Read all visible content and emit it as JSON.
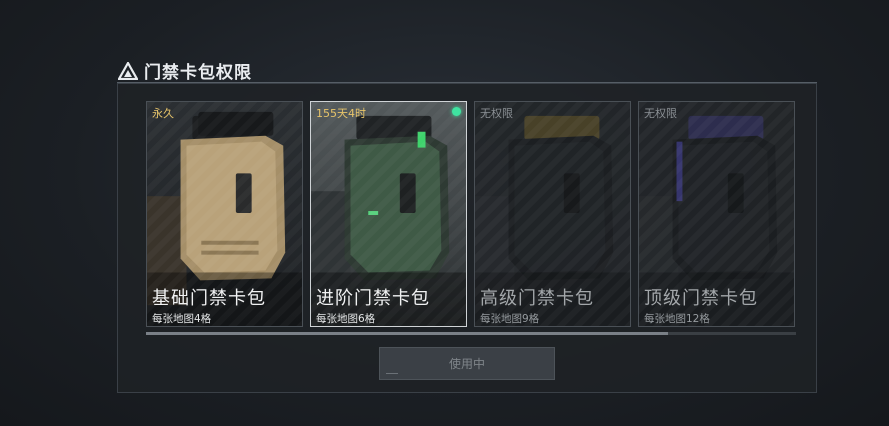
{
  "panel": {
    "title": "门禁卡包权限"
  },
  "cards": [
    {
      "name": "基础门禁卡包",
      "desc": "每张地图4格",
      "status": "永久",
      "active": false,
      "locked": false,
      "color": "#b9a27a"
    },
    {
      "name": "进阶门禁卡包",
      "desc": "每张地图6格",
      "status": "155天4时",
      "active": true,
      "locked": false,
      "color": "#4f6f52"
    },
    {
      "name": "高级门禁卡包",
      "desc": "每张地图9格",
      "status": "无权限",
      "active": false,
      "locked": true,
      "color": "#d1b24a"
    },
    {
      "name": "顶级门禁卡包",
      "desc": "每张地图12格",
      "status": "无权限",
      "active": false,
      "locked": true,
      "color": "#6a5fd6"
    }
  ],
  "scroll": {
    "position": 0.8
  },
  "action": {
    "button_label": "使用中",
    "enabled": false
  },
  "colors": {
    "active_dot": "#3fe3a0",
    "status_gold": "#e7c46a"
  }
}
